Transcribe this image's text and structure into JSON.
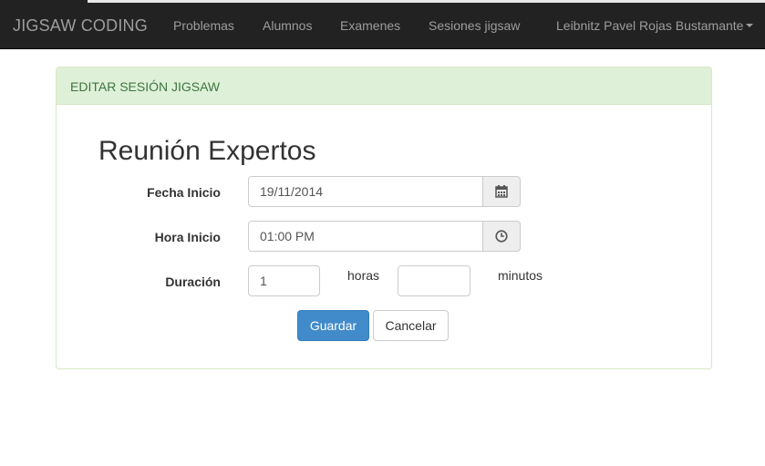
{
  "navbar": {
    "brand": "JIGSAW CODING",
    "links": [
      "Problemas",
      "Alumnos",
      "Examenes",
      "Sesiones jigsaw"
    ],
    "user": "Leibnitz Pavel Rojas Bustamante"
  },
  "panel": {
    "heading": "EDITAR SESIÓN JIGSAW",
    "title": "Reunión Expertos"
  },
  "form": {
    "fecha_label": "Fecha Inicio",
    "fecha_value": "19/11/2014",
    "hora_label": "Hora Inicio",
    "hora_value": "01:00 PM",
    "duracion_label": "Duración",
    "horas_value": "1",
    "horas_unit": "horas",
    "minutos_value": "",
    "minutos_unit": "minutos"
  },
  "buttons": {
    "save": "Guardar",
    "cancel": "Cancelar"
  },
  "icons": {
    "date_picker": "calendar-icon",
    "time_picker": "clock-icon"
  },
  "colors": {
    "navbar_bg": "#222222",
    "panel_heading_bg": "#dff0d8",
    "panel_heading_text": "#3c763d",
    "primary": "#428bca"
  }
}
